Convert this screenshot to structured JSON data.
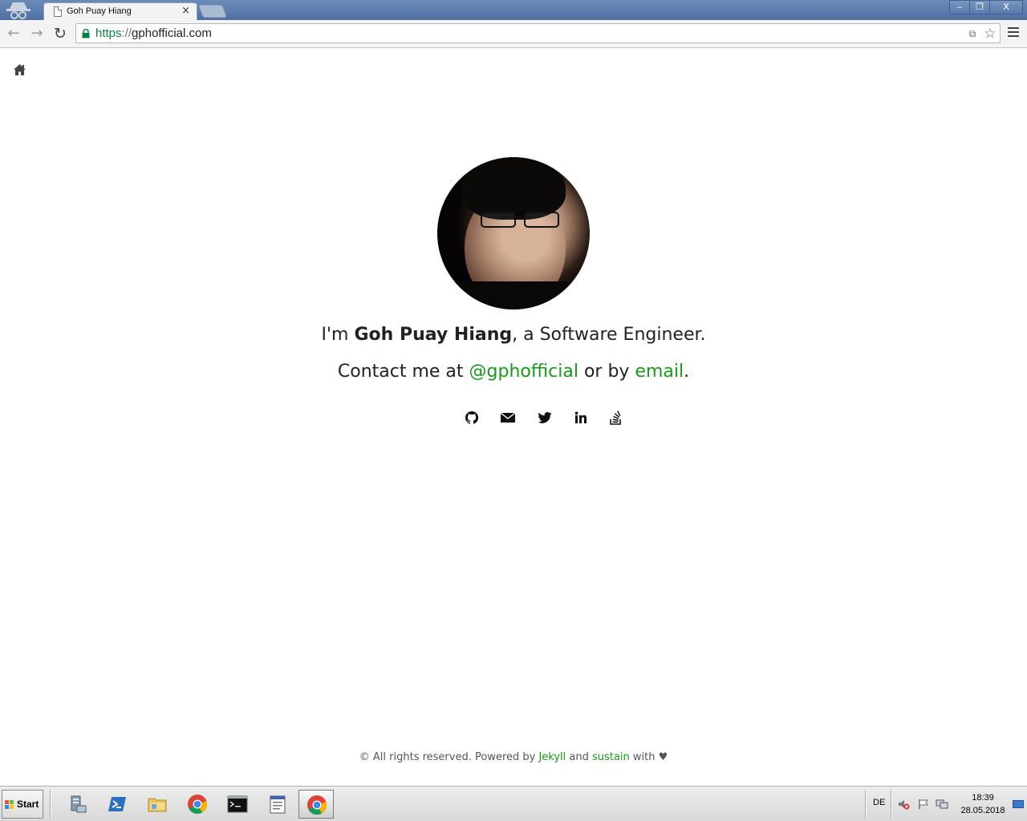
{
  "browser": {
    "tab_title": "Goh Puay Hiang",
    "tab_close": "×",
    "url_scheme": "https",
    "url_sep": "://",
    "url_host": "gphofficial.com",
    "window_minimize": "‒",
    "window_maximize": "❐",
    "window_close": "X",
    "back_icon": "←",
    "forward_icon": "→",
    "reload_icon": "↻",
    "star_icon": "☆",
    "translate_icon": "⧉"
  },
  "page": {
    "intro_prefix": "I'm ",
    "name": "Goh Puay Hiang",
    "intro_suffix": ", a Software Engineer.",
    "contact_prefix": "Contact me at ",
    "twitter_handle": "@gphofficial",
    "contact_middle": " or by ",
    "email_link": "email",
    "contact_suffix": ".",
    "socials": [
      "github",
      "email",
      "twitter",
      "linkedin",
      "stackoverflow"
    ],
    "link_color": "#1a9a1a"
  },
  "footer": {
    "prefix": "© All rights reserved. Powered by ",
    "jekyll": "Jekyll",
    "and": " and ",
    "sustain": "sustain",
    "suffix": " with ♥"
  },
  "taskbar": {
    "start_label": "Start",
    "language": "DE",
    "time": "18:39",
    "date": "28.05.2018",
    "apps": [
      "server-manager",
      "powershell",
      "explorer",
      "chrome",
      "cmd",
      "notepad",
      "chrome-active"
    ]
  }
}
